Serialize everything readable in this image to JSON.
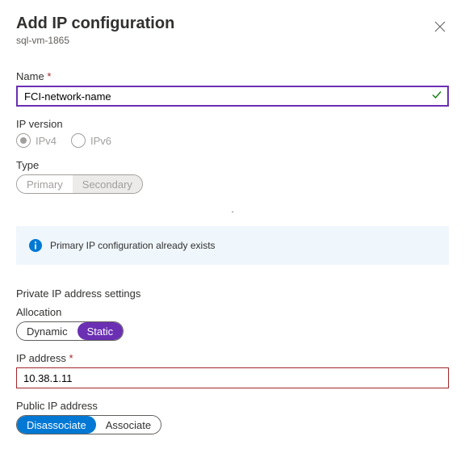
{
  "header": {
    "title": "Add IP configuration",
    "subtitle": "sql-vm-1865"
  },
  "name_field": {
    "label": "Name",
    "value": "FCI-network-name"
  },
  "ip_version": {
    "label": "IP version",
    "options": [
      "IPv4",
      "IPv6"
    ],
    "selected": "IPv4"
  },
  "type_field": {
    "label": "Type",
    "options": [
      "Primary",
      "Secondary"
    ]
  },
  "info_message": "Primary IP configuration already exists",
  "private_section": {
    "title": "Private IP address settings",
    "allocation": {
      "label": "Allocation",
      "options": [
        "Dynamic",
        "Static"
      ],
      "selected": "Static"
    },
    "ip_address": {
      "label": "IP address",
      "value": "10.38.1.11"
    }
  },
  "public_section": {
    "label": "Public IP address",
    "options": [
      "Disassociate",
      "Associate"
    ],
    "selected": "Disassociate"
  }
}
